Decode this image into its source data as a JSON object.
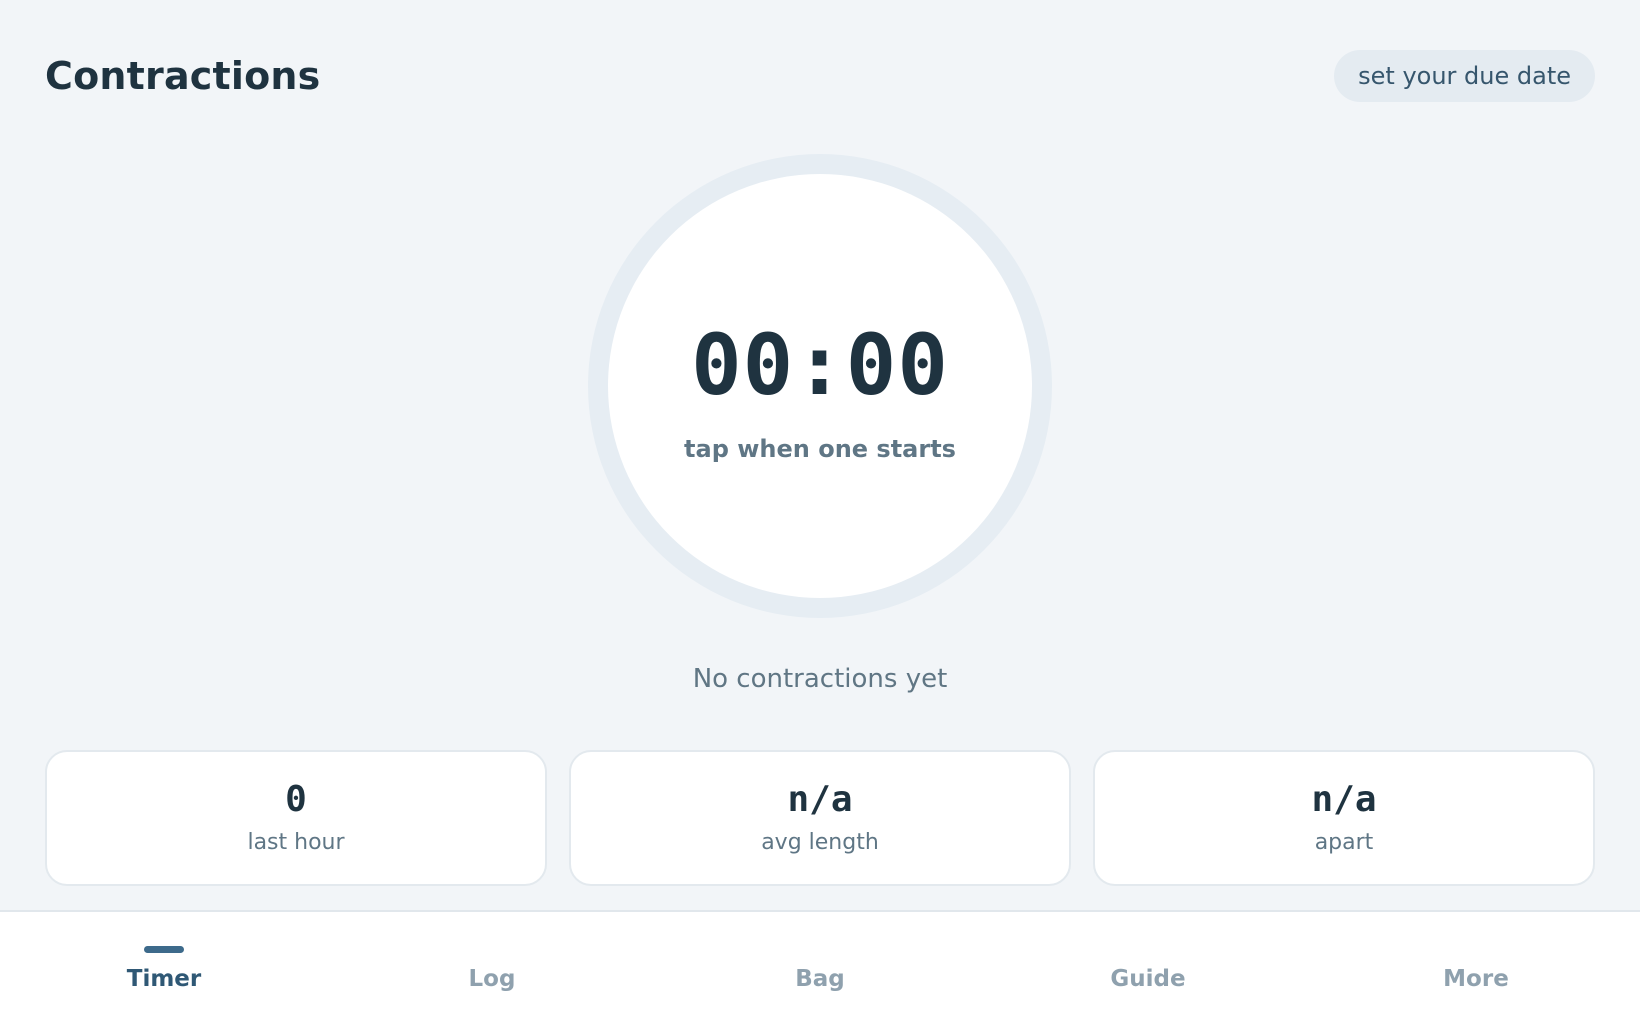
{
  "header": {
    "title": "Contractions",
    "due_date_button": "set your due date"
  },
  "timer": {
    "value": "00:00",
    "hint": "tap when one starts"
  },
  "status": {
    "empty_message": "No contractions yet"
  },
  "stats": [
    {
      "value": "0",
      "label": "last hour"
    },
    {
      "value": "n/a",
      "label": "avg length"
    },
    {
      "value": "n/a",
      "label": "apart"
    }
  ],
  "nav": {
    "active": "Timer",
    "tabs": [
      {
        "label": "Timer"
      },
      {
        "label": "Log"
      },
      {
        "label": "Bag"
      },
      {
        "label": "Guide"
      },
      {
        "label": "More"
      }
    ]
  }
}
